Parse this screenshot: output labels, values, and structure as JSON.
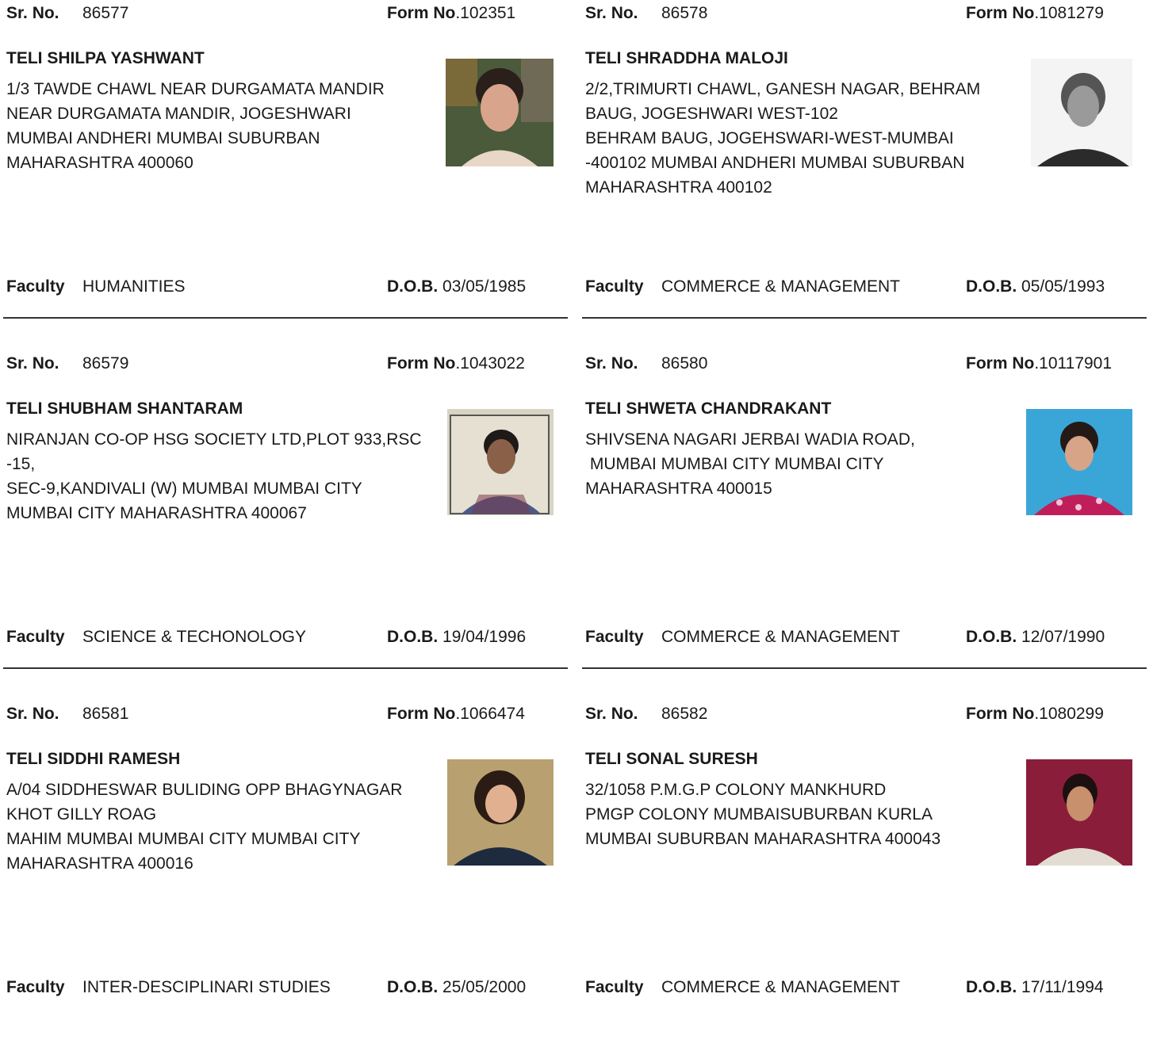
{
  "labels": {
    "sr_no": "Sr. No.",
    "form_no": "Form No",
    "faculty": "Faculty",
    "dob": "D.O.B."
  },
  "records": [
    {
      "sr_no": "86577",
      "form_no": ".102351",
      "name": "TELI SHILPA YASHWANT",
      "address": [
        "1/3 TAWDE CHAWL NEAR DURGAMATA MANDIR",
        "NEAR DURGAMATA MANDIR, JOGESHWARI",
        "MUMBAI ANDHERI MUMBAI SUBURBAN",
        "MAHARASHTRA 400060"
      ],
      "faculty": "HUMANITIES",
      "dob": "03/05/1985",
      "photo_icon": "person-photo-icon"
    },
    {
      "sr_no": "86578",
      "form_no": ".1081279",
      "name": "TELI SHRADDHA MALOJI",
      "address": [
        "2/2,TRIMURTI CHAWL, GANESH NAGAR, BEHRAM",
        "BAUG, JOGESHWARI WEST-102",
        "BEHRAM BAUG, JOGEHSWARI-WEST-MUMBAI",
        "-400102 MUMBAI ANDHERI MUMBAI SUBURBAN",
        "MAHARASHTRA 400102"
      ],
      "faculty": "COMMERCE & MANAGEMENT",
      "dob": "05/05/1993",
      "photo_icon": "person-photo-icon"
    },
    {
      "sr_no": "86579",
      "form_no": ".1043022",
      "name": "TELI SHUBHAM SHANTARAM",
      "address": [
        "NIRANJAN CO-OP HSG SOCIETY LTD,PLOT 933,RSC",
        "-15,",
        "SEC-9,KANDIVALI (W) MUMBAI MUMBAI CITY",
        "MUMBAI CITY MAHARASHTRA 400067"
      ],
      "faculty": "SCIENCE & TECHONOLOGY",
      "dob": "19/04/1996",
      "photo_icon": "person-photo-icon"
    },
    {
      "sr_no": "86580",
      "form_no": ".10117901",
      "name": "TELI SHWETA CHANDRAKANT",
      "address": [
        "SHIVSENA NAGARI JERBAI WADIA ROAD,",
        " MUMBAI MUMBAI CITY MUMBAI CITY",
        "MAHARASHTRA 400015"
      ],
      "faculty": "COMMERCE & MANAGEMENT",
      "dob": "12/07/1990",
      "photo_icon": "person-photo-icon"
    },
    {
      "sr_no": "86581",
      "form_no": ".1066474",
      "name": "TELI SIDDHI RAMESH",
      "address": [
        "A/04 SIDDHESWAR BULIDING OPP BHAGYNAGAR",
        "KHOT GILLY ROAG",
        "MAHIM MUMBAI MUMBAI CITY MUMBAI CITY",
        "MAHARASHTRA 400016"
      ],
      "faculty": "INTER-DESCIPLINARI STUDIES",
      "dob": "25/05/2000",
      "photo_icon": "person-photo-icon"
    },
    {
      "sr_no": "86582",
      "form_no": ".1080299",
      "name": "TELI SONAL SURESH",
      "address": [
        "32/1058 P.M.G.P COLONY MANKHURD",
        "PMGP COLONY MUMBAISUBURBAN KURLA",
        "MUMBAI SUBURBAN MAHARASHTRA 400043"
      ],
      "faculty": "COMMERCE & MANAGEMENT",
      "dob": "17/11/1994",
      "photo_icon": "person-photo-icon"
    }
  ]
}
